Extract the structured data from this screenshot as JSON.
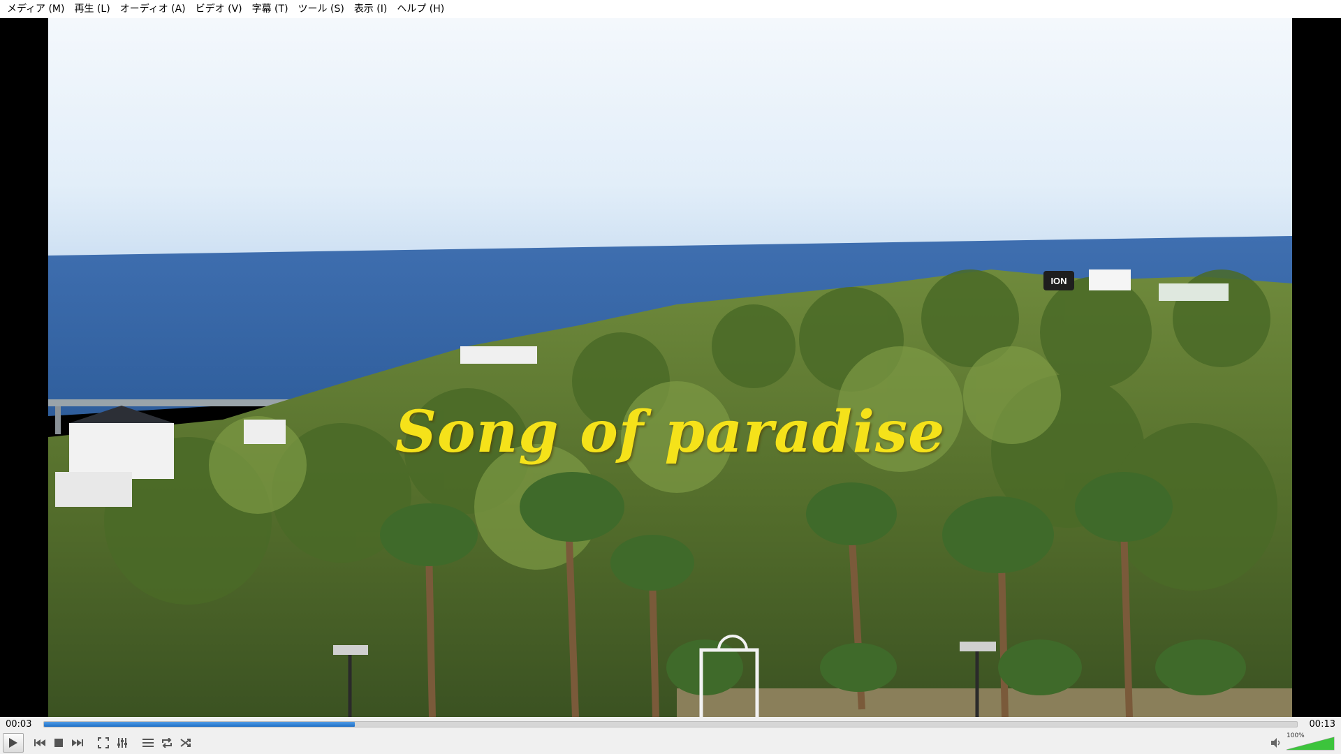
{
  "menu": [
    {
      "label": "メディア (M)"
    },
    {
      "label": "再生 (L)"
    },
    {
      "label": "オーディオ (A)"
    },
    {
      "label": "ビデオ (V)"
    },
    {
      "label": "字幕 (T)"
    },
    {
      "label": "ツール (S)"
    },
    {
      "label": "表示 (I)"
    },
    {
      "label": "ヘルプ (H)"
    }
  ],
  "video": {
    "title_overlay": "Song of paradise",
    "sign_text": "ION"
  },
  "seek": {
    "elapsed": "00:03",
    "total": "00:13",
    "progress_fraction": 0.248
  },
  "controls": {
    "icons": [
      "play-icon",
      "previous-icon",
      "stop-icon",
      "next-icon",
      "fullscreen-icon",
      "extended-settings-icon",
      "playlist-icon",
      "loop-icon",
      "shuffle-icon"
    ]
  },
  "volume": {
    "label": "100%",
    "level_fraction": 1.0,
    "icon": "speaker-icon"
  },
  "colors": {
    "accent": "#1f6fc4",
    "title_text": "#f5e21a",
    "volume_fill": "#3cc43c"
  }
}
